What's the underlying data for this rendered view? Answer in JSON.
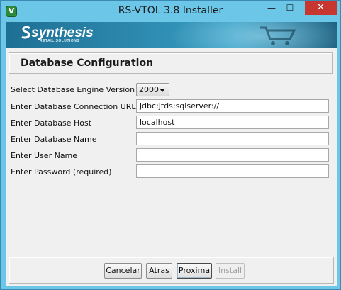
{
  "window": {
    "title": "RS-VTOL 3.8 Installer",
    "app_icon_letter": "V",
    "minimize_glyph": "—",
    "maximize_glyph": "☐",
    "close_glyph": "✕"
  },
  "banner": {
    "logo_text": "synthesis",
    "tagline": "RETAIL SOLUTIONS",
    "icon": "shopping-cart-icon"
  },
  "section": {
    "title": "Database Configuration"
  },
  "form": {
    "engine_version": {
      "label": "Select Database Engine Version",
      "selected": "2000"
    },
    "connection_url": {
      "label": "Enter Database Connection URL",
      "value": "jdbc:jtds:sqlserver://"
    },
    "host": {
      "label": "Enter Database Host",
      "value": "localhost"
    },
    "db_name": {
      "label": "Enter Database Name",
      "value": ""
    },
    "user_name": {
      "label": "Enter User Name",
      "value": ""
    },
    "password": {
      "label": "Enter Password (required)",
      "value": ""
    }
  },
  "buttons": {
    "cancel": "Cancelar",
    "back": "Atras",
    "next": "Proxima",
    "install": "Install"
  },
  "colors": {
    "title_bar": "#6bc6e8",
    "close_button": "#c7372f",
    "banner": "#2f8cb2"
  }
}
